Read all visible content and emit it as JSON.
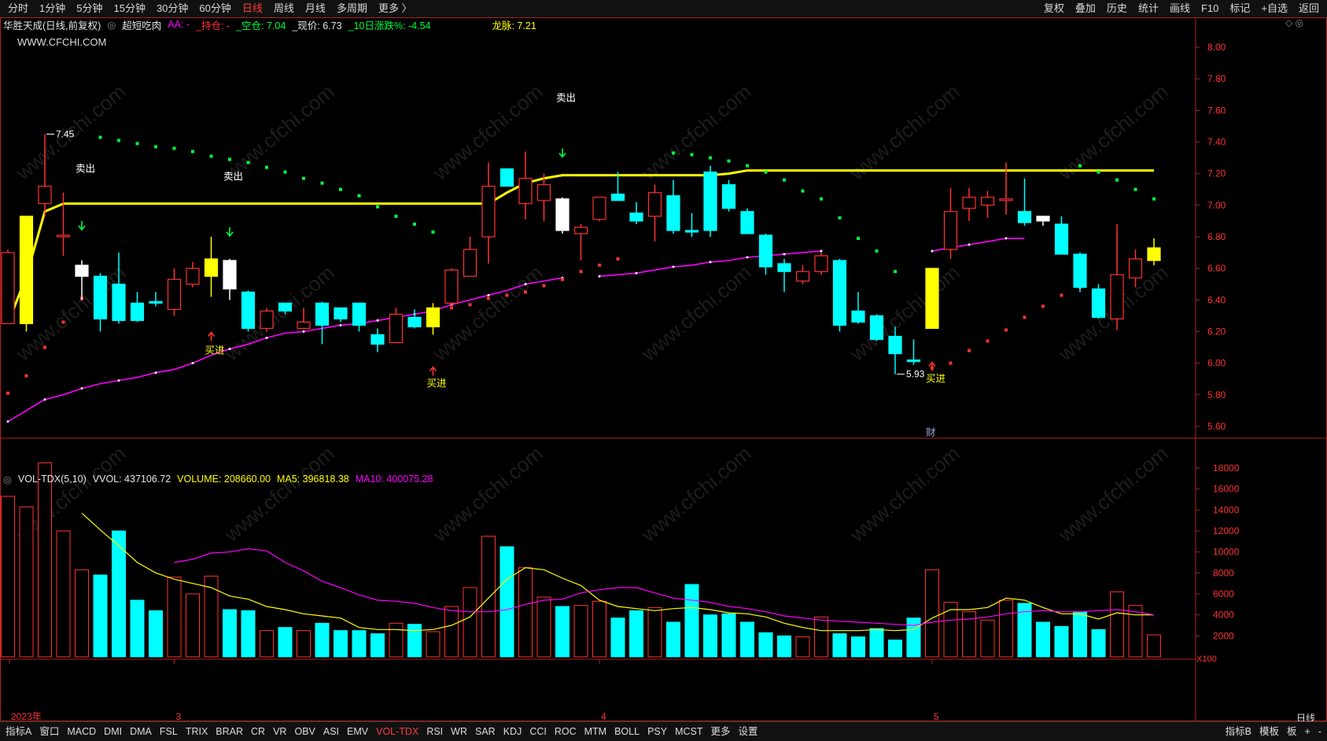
{
  "topbar": {
    "left": [
      {
        "label": "分时",
        "active": false
      },
      {
        "label": "1分钟",
        "active": false
      },
      {
        "label": "5分钟",
        "active": false
      },
      {
        "label": "15分钟",
        "active": false
      },
      {
        "label": "30分钟",
        "active": false
      },
      {
        "label": "60分钟",
        "active": false
      },
      {
        "label": "日线",
        "active": true
      },
      {
        "label": "周线",
        "active": false
      },
      {
        "label": "月线",
        "active": false
      },
      {
        "label": "多周期",
        "active": false
      },
      {
        "label": "更多 〉",
        "active": false
      }
    ],
    "right": [
      "复权",
      "叠加",
      "历史",
      "统计",
      "画线",
      "F10",
      "标记",
      "+自选",
      "返回"
    ]
  },
  "header": {
    "stock": "华胜天成(日线,前复权)",
    "indicator_toggle": "◎",
    "indicator": "超短吃肉",
    "aa": "AA: -",
    "hold": "_持仓: -",
    "empty": "_空仓: 7.04",
    "price": "_现价: 6.73",
    "change": "_10日涨跌%: -4.54",
    "longmai": "龙脉: 7.21"
  },
  "site": "WWW.CFCHI.COM",
  "watermark": "www.cfchi.com",
  "colors": {
    "up": "#ff3232",
    "down": "#00ffff",
    "yellow": "#ffff00",
    "magenta": "#ff00ff",
    "green": "#00ff3c",
    "white": "#ffffff",
    "axis": "#c0392b"
  },
  "chart_data": [
    {
      "type": "candlestick",
      "title": "华胜天成(日线,前复权)",
      "ylim": [
        5.55,
        8.1
      ],
      "y_ticks": [
        "8.00",
        "7.80",
        "7.60",
        "7.40",
        "7.20",
        "7.00",
        "6.80",
        "6.60",
        "6.40",
        "6.20",
        "6.00",
        "5.80",
        "5.60"
      ],
      "x_labels": [
        "2023年",
        "3",
        "4",
        "5"
      ],
      "candles": [
        {
          "o": 6.25,
          "h": 6.72,
          "l": 6.25,
          "c": 6.7
        },
        {
          "o": 6.25,
          "h": 6.93,
          "l": 6.2,
          "c": 6.93,
          "mark": "yellow"
        },
        {
          "o": 7.01,
          "h": 7.45,
          "l": 6.93,
          "c": 7.12
        },
        {
          "o": 6.8,
          "h": 7.08,
          "l": 6.68,
          "c": 6.81
        },
        {
          "o": 6.55,
          "h": 6.65,
          "l": 6.4,
          "c": 6.62,
          "mark": "white"
        },
        {
          "o": 6.55,
          "h": 6.57,
          "l": 6.2,
          "c": 6.28
        },
        {
          "o": 6.5,
          "h": 6.7,
          "l": 6.25,
          "c": 6.27
        },
        {
          "o": 6.38,
          "h": 6.45,
          "l": 6.26,
          "c": 6.27
        },
        {
          "o": 6.39,
          "h": 6.45,
          "l": 6.36,
          "c": 6.38
        },
        {
          "o": 6.34,
          "h": 6.6,
          "l": 6.3,
          "c": 6.53
        },
        {
          "o": 6.5,
          "h": 6.64,
          "l": 6.48,
          "c": 6.6
        },
        {
          "o": 6.55,
          "h": 6.8,
          "l": 6.42,
          "c": 6.66,
          "mark": "yellow"
        },
        {
          "o": 6.65,
          "h": 6.66,
          "l": 6.4,
          "c": 6.47,
          "mark": "white"
        },
        {
          "o": 6.45,
          "h": 6.46,
          "l": 6.2,
          "c": 6.22
        },
        {
          "o": 6.22,
          "h": 6.35,
          "l": 6.2,
          "c": 6.33
        },
        {
          "o": 6.38,
          "h": 6.38,
          "l": 6.31,
          "c": 6.33
        },
        {
          "o": 6.22,
          "h": 6.35,
          "l": 6.22,
          "c": 6.26
        },
        {
          "o": 6.38,
          "h": 6.39,
          "l": 6.12,
          "c": 6.24
        },
        {
          "o": 6.35,
          "h": 6.35,
          "l": 6.26,
          "c": 6.28
        },
        {
          "o": 6.38,
          "h": 6.38,
          "l": 6.2,
          "c": 6.24
        },
        {
          "o": 6.18,
          "h": 6.22,
          "l": 6.07,
          "c": 6.12
        },
        {
          "o": 6.13,
          "h": 6.35,
          "l": 6.13,
          "c": 6.31
        },
        {
          "o": 6.29,
          "h": 6.34,
          "l": 6.22,
          "c": 6.23
        },
        {
          "o": 6.23,
          "h": 6.38,
          "l": 6.18,
          "c": 6.35,
          "mark": "yellow"
        },
        {
          "o": 6.38,
          "h": 6.6,
          "l": 6.36,
          "c": 6.59
        },
        {
          "o": 6.55,
          "h": 6.8,
          "l": 6.55,
          "c": 6.72
        },
        {
          "o": 6.8,
          "h": 7.27,
          "l": 6.63,
          "c": 7.12
        },
        {
          "o": 7.23,
          "h": 7.23,
          "l": 7.12,
          "c": 7.12
        },
        {
          "o": 7.01,
          "h": 7.34,
          "l": 6.91,
          "c": 7.17
        },
        {
          "o": 7.03,
          "h": 7.2,
          "l": 6.9,
          "c": 7.13
        },
        {
          "o": 7.04,
          "h": 7.05,
          "l": 6.82,
          "c": 6.84,
          "mark": "white"
        },
        {
          "o": 6.82,
          "h": 6.88,
          "l": 6.65,
          "c": 6.86
        },
        {
          "o": 6.91,
          "h": 7.05,
          "l": 6.9,
          "c": 7.05
        },
        {
          "o": 7.07,
          "h": 7.21,
          "l": 7.03,
          "c": 7.03
        },
        {
          "o": 6.95,
          "h": 7.02,
          "l": 6.88,
          "c": 6.9
        },
        {
          "o": 6.93,
          "h": 7.13,
          "l": 6.77,
          "c": 7.08
        },
        {
          "o": 7.06,
          "h": 7.16,
          "l": 6.82,
          "c": 6.84
        },
        {
          "o": 6.84,
          "h": 6.95,
          "l": 6.8,
          "c": 6.83
        },
        {
          "o": 7.21,
          "h": 7.25,
          "l": 6.8,
          "c": 6.84
        },
        {
          "o": 7.13,
          "h": 7.16,
          "l": 6.96,
          "c": 6.98
        },
        {
          "o": 6.96,
          "h": 6.98,
          "l": 6.82,
          "c": 6.82
        },
        {
          "o": 6.81,
          "h": 6.82,
          "l": 6.56,
          "c": 6.61
        },
        {
          "o": 6.63,
          "h": 6.66,
          "l": 6.45,
          "c": 6.58
        },
        {
          "o": 6.52,
          "h": 6.62,
          "l": 6.5,
          "c": 6.58
        },
        {
          "o": 6.58,
          "h": 6.7,
          "l": 6.56,
          "c": 6.68
        },
        {
          "o": 6.65,
          "h": 6.66,
          "l": 6.2,
          "c": 6.24
        },
        {
          "o": 6.33,
          "h": 6.45,
          "l": 6.25,
          "c": 6.26
        },
        {
          "o": 6.3,
          "h": 6.31,
          "l": 6.14,
          "c": 6.15
        },
        {
          "o": 6.17,
          "h": 6.23,
          "l": 5.93,
          "c": 6.06
        },
        {
          "o": 6.02,
          "h": 6.15,
          "l": 5.99,
          "c": 6.01
        },
        {
          "o": 6.22,
          "h": 6.6,
          "l": 6.22,
          "c": 6.6,
          "mark": "yellow"
        },
        {
          "o": 6.72,
          "h": 7.11,
          "l": 6.66,
          "c": 6.96
        },
        {
          "o": 6.98,
          "h": 7.11,
          "l": 6.9,
          "c": 7.05
        },
        {
          "o": 7.0,
          "h": 7.09,
          "l": 6.92,
          "c": 7.05
        },
        {
          "o": 7.04,
          "h": 7.27,
          "l": 6.94,
          "c": 7.04
        },
        {
          "o": 6.96,
          "h": 7.17,
          "l": 6.87,
          "c": 6.89
        },
        {
          "o": 6.93,
          "h": 6.93,
          "l": 6.87,
          "c": 6.9,
          "mark": "white"
        },
        {
          "o": 6.88,
          "h": 6.93,
          "l": 6.7,
          "c": 6.69
        },
        {
          "o": 6.69,
          "h": 6.7,
          "l": 6.45,
          "c": 6.48
        },
        {
          "o": 6.47,
          "h": 6.5,
          "l": 6.28,
          "c": 6.29
        },
        {
          "o": 6.28,
          "h": 6.88,
          "l": 6.21,
          "c": 6.56
        },
        {
          "o": 6.54,
          "h": 6.72,
          "l": 6.48,
          "c": 6.66
        },
        {
          "o": 6.65,
          "h": 6.79,
          "l": 6.62,
          "c": 6.73,
          "mark": "yellow"
        }
      ],
      "price_labels": [
        {
          "label": "7.45",
          "candle": 2,
          "value": 7.45
        },
        {
          "label": "5.93",
          "candle": 48,
          "value": 5.93
        }
      ],
      "signals": [
        {
          "label": "卖出",
          "candle": 4,
          "value": 7.23
        },
        {
          "label": "卖出",
          "candle": 12,
          "value": 7.18
        },
        {
          "label": "卖出",
          "candle": 30,
          "value": 7.68
        },
        {
          "label": "买进",
          "candle": 11,
          "value": 6.08
        },
        {
          "label": "买进",
          "candle": 23,
          "value": 5.87
        },
        {
          "label": "买进",
          "candle": 50,
          "value": 5.9
        },
        {
          "label": "财",
          "candle": 50,
          "value": 5.56
        }
      ],
      "longmai_line": [
        6.25,
        6.55,
        6.96,
        7.01,
        7.01,
        7.01,
        7.01,
        7.01,
        7.01,
        7.01,
        7.01,
        7.01,
        7.01,
        7.01,
        7.01,
        7.01,
        7.01,
        7.01,
        7.01,
        7.01,
        7.01,
        7.01,
        7.01,
        7.01,
        7.01,
        7.01,
        7.01,
        7.08,
        7.14,
        7.17,
        7.19,
        7.19,
        7.19,
        7.19,
        7.19,
        7.19,
        7.19,
        7.19,
        7.19,
        7.2,
        7.22,
        7.22,
        7.22,
        7.22,
        7.22,
        7.22,
        7.22,
        7.22,
        7.22,
        7.22,
        7.22,
        7.22,
        7.22,
        7.22,
        7.22,
        7.22,
        7.22,
        7.22,
        7.22,
        7.22,
        7.22,
        7.22,
        7.22
      ],
      "ma_line": [
        5.63,
        5.7,
        5.77,
        5.8,
        5.84,
        5.87,
        5.89,
        5.91,
        5.94,
        5.96,
        6.0,
        6.05,
        6.09,
        6.12,
        6.16,
        6.19,
        6.2,
        6.22,
        6.24,
        6.25,
        6.27,
        6.29,
        6.31,
        6.33,
        6.37,
        6.4,
        6.43,
        6.46,
        6.5,
        6.52,
        6.54,
        null,
        6.55,
        6.56,
        6.57,
        6.59,
        6.61,
        6.62,
        6.64,
        6.65,
        6.67,
        6.68,
        6.69,
        6.7,
        6.71,
        null,
        null,
        null,
        null,
        null,
        6.71,
        6.73,
        6.75,
        6.77,
        6.79,
        6.79,
        null,
        null,
        null,
        null,
        null,
        null,
        null
      ],
      "green_dots": [
        null,
        null,
        null,
        null,
        null,
        7.43,
        7.41,
        7.39,
        7.37,
        7.36,
        7.34,
        7.31,
        7.29,
        7.27,
        7.24,
        7.21,
        7.17,
        7.14,
        7.1,
        7.06,
        6.99,
        6.93,
        6.88,
        6.83,
        null,
        null,
        null,
        null,
        null,
        null,
        null,
        null,
        null,
        null,
        null,
        null,
        7.33,
        7.32,
        7.3,
        7.28,
        7.25,
        7.21,
        7.16,
        7.09,
        7.04,
        6.92,
        6.79,
        6.71,
        6.58,
        null,
        null,
        null,
        null,
        null,
        null,
        null,
        null,
        null,
        7.25,
        7.21,
        7.16,
        7.1,
        7.04
      ],
      "red_dots": [
        5.81,
        5.92,
        6.1,
        6.26,
        6.41,
        null,
        null,
        null,
        null,
        null,
        null,
        null,
        null,
        null,
        null,
        null,
        null,
        null,
        null,
        null,
        null,
        null,
        null,
        null,
        6.35,
        6.37,
        6.41,
        6.43,
        6.45,
        6.49,
        6.53,
        6.58,
        6.62,
        6.66,
        null,
        null,
        null,
        null,
        null,
        null,
        null,
        null,
        null,
        null,
        null,
        null,
        null,
        null,
        null,
        null,
        5.97,
        6.0,
        6.08,
        6.14,
        6.21,
        6.29,
        6.36,
        6.43,
        6.48,
        null,
        null,
        null,
        null
      ],
      "green_arrows": [
        {
          "candle": 4,
          "value": 6.86
        },
        {
          "candle": 12,
          "value": 6.82
        },
        {
          "candle": 30,
          "value": 7.32
        }
      ],
      "red_arrows": [
        {
          "candle": 11,
          "value": 6.18
        },
        {
          "candle": 23,
          "value": 5.96
        },
        {
          "candle": 50,
          "value": 5.99
        }
      ]
    },
    {
      "type": "bar",
      "title": "VOL-TDX(5,10)",
      "ylim": [
        0,
        19500
      ],
      "y_ticks": [
        "18000",
        "16000",
        "14000",
        "12000",
        "10000",
        "8000",
        "6000",
        "4000",
        "2000"
      ],
      "unit": "X100",
      "values": [
        15300,
        14300,
        18500,
        12000,
        8300,
        7800,
        12000,
        5400,
        4400,
        7600,
        6000,
        7700,
        4500,
        4400,
        2500,
        2800,
        2500,
        3200,
        2500,
        2500,
        2200,
        3200,
        3100,
        2400,
        4800,
        6600,
        11500,
        10500,
        8500,
        5700,
        4800,
        4900,
        5300,
        3700,
        4400,
        4700,
        3300,
        6900,
        4000,
        4100,
        3300,
        2300,
        2000,
        1900,
        3800,
        2200,
        1900,
        2700,
        1600,
        3700,
        8300,
        5200,
        4300,
        3500,
        5400,
        5100,
        3300,
        2900,
        4300,
        2600,
        6200,
        4900,
        2100
      ],
      "ma5": [
        null,
        null,
        null,
        null,
        13700,
        12100,
        10600,
        9000,
        8000,
        7400,
        7000,
        6600,
        5800,
        5500,
        4800,
        4500,
        4100,
        3900,
        3700,
        2800,
        2600,
        2600,
        2500,
        2600,
        3000,
        3800,
        5600,
        7400,
        8500,
        8300,
        7500,
        6800,
        5400,
        4800,
        4600,
        4400,
        4600,
        4700,
        4500,
        4200,
        4100,
        3800,
        3200,
        2800,
        2500,
        2500,
        2500,
        2600,
        2500,
        2600,
        3700,
        4500,
        4500,
        4700,
        5600,
        5400,
        4700,
        4100,
        4100,
        3600,
        4200,
        4000,
        4000
      ],
      "ma10": [
        null,
        null,
        null,
        null,
        null,
        null,
        null,
        null,
        null,
        9000,
        9300,
        9900,
        10000,
        10300,
        10100,
        9000,
        8200,
        7200,
        6600,
        5900,
        5400,
        5300,
        5100,
        4700,
        4400,
        4300,
        4300,
        4500,
        5000,
        5400,
        5500,
        6100,
        6400,
        6600,
        6600,
        6100,
        5600,
        5400,
        5200,
        4800,
        4600,
        4300,
        3900,
        3700,
        3500,
        3400,
        3300,
        3200,
        3100,
        3000,
        3300,
        3500,
        3600,
        3800,
        4100,
        4300,
        4400,
        4300,
        4300,
        4400,
        4500,
        4300,
        4000
      ]
    }
  ],
  "vol_header": {
    "toggle": "◎",
    "name": "VOL-TDX(5,10)",
    "vvol": "VVOL: 437106.72",
    "volume": "VOLUME: 208660.00",
    "ma5": "MA5: 396818.38",
    "ma10": "MA10: 400075.28"
  },
  "right_labels": {
    "period": "日线",
    "unit": "X100"
  },
  "bottombar": {
    "left": [
      "指标A",
      "窗口",
      "MACD",
      "DMI",
      "DMA",
      "FSL",
      "TRIX",
      "BRAR",
      "CR",
      "VR",
      "OBV",
      "ASI",
      "EMV",
      "VOL-TDX",
      "RSI",
      "WR",
      "SAR",
      "KDJ",
      "CCI",
      "ROC",
      "MTM",
      "BOLL",
      "PSY",
      "MCST",
      "更多",
      "设置"
    ],
    "active": "VOL-TDX",
    "right": [
      "指标B",
      "模板",
      "板",
      "+",
      "-"
    ]
  }
}
